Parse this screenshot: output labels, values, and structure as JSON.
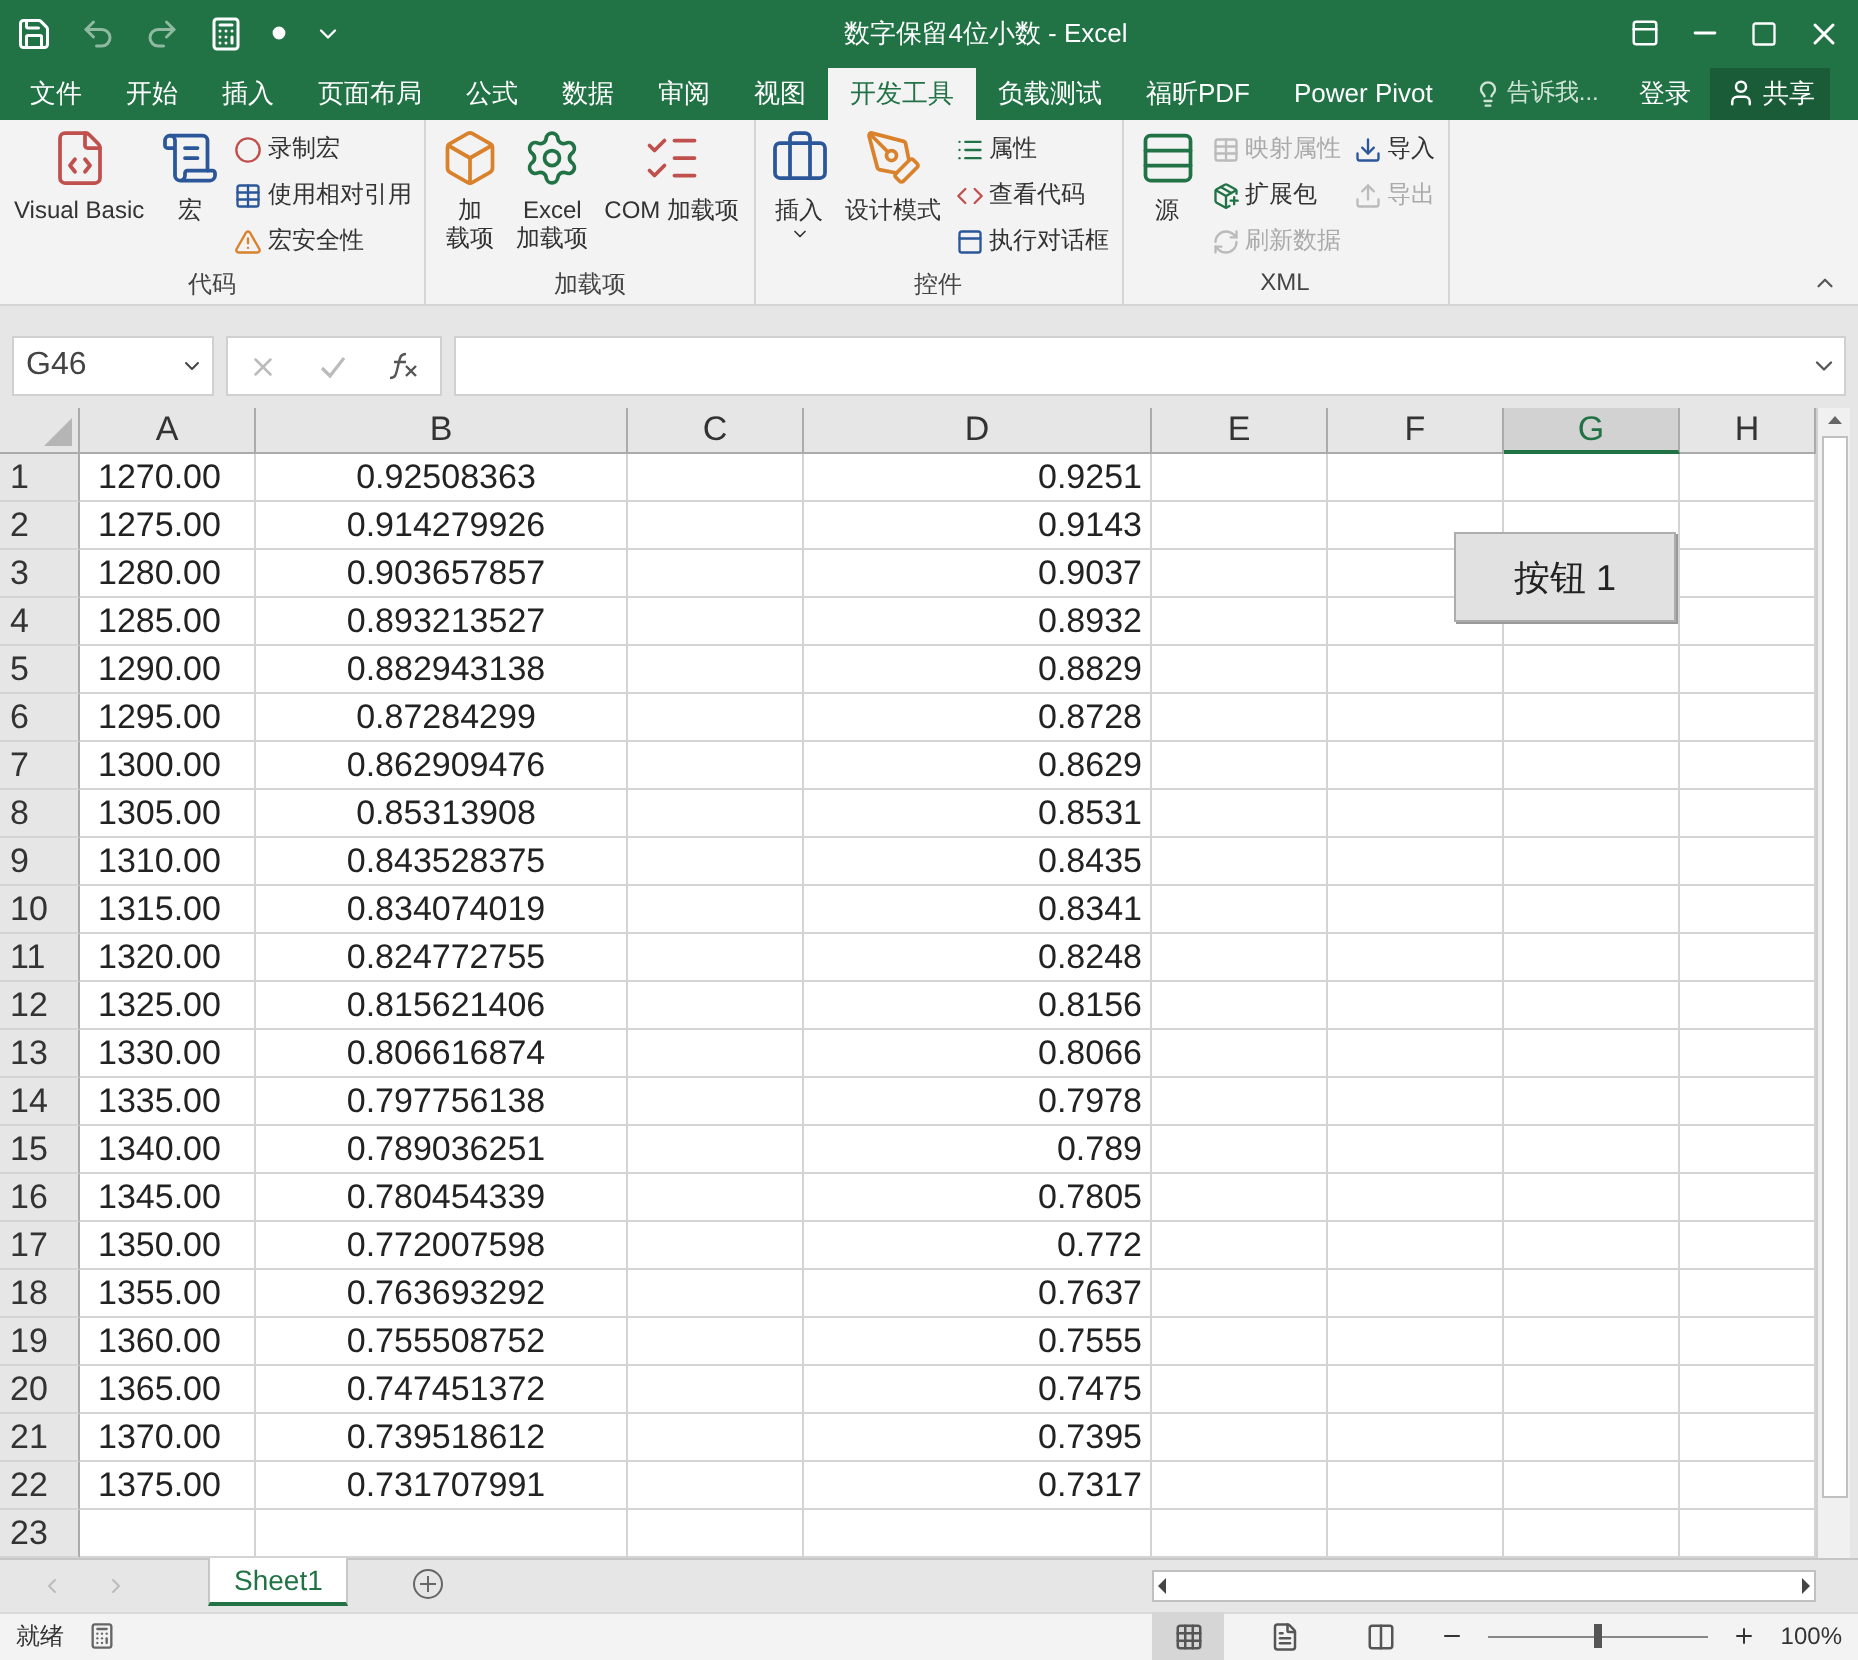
{
  "window": {
    "title": "数字保留4位小数 - Excel"
  },
  "tabs": [
    {
      "label": "文件",
      "selected": false
    },
    {
      "label": "开始",
      "selected": false
    },
    {
      "label": "插入",
      "selected": false
    },
    {
      "label": "页面布局",
      "selected": false
    },
    {
      "label": "公式",
      "selected": false
    },
    {
      "label": "数据",
      "selected": false
    },
    {
      "label": "审阅",
      "selected": false
    },
    {
      "label": "视图",
      "selected": false
    },
    {
      "label": "开发工具",
      "selected": true
    },
    {
      "label": "负载测试",
      "selected": false
    },
    {
      "label": "福昕PDF",
      "selected": false
    },
    {
      "label": "Power Pivot",
      "selected": false
    }
  ],
  "tell_me": {
    "placeholder": "告诉我..."
  },
  "login": "登录",
  "share": "共享",
  "ribbon_groups": [
    {
      "name": "代码",
      "items": [
        {
          "kind": "large",
          "lines": [
            "Visual Basic"
          ],
          "disabled": false
        },
        {
          "kind": "large",
          "lines": [
            "宏"
          ],
          "disabled": false
        },
        {
          "kind": "small",
          "lines": [
            "录制宏"
          ],
          "disabled": false
        },
        {
          "kind": "small",
          "lines": [
            "使用相对引用"
          ],
          "disabled": false
        },
        {
          "kind": "small",
          "lines": [
            "宏安全性"
          ],
          "disabled": false
        }
      ]
    },
    {
      "name": "加载项",
      "items": [
        {
          "kind": "large",
          "lines": [
            "加",
            "载项"
          ],
          "disabled": false
        },
        {
          "kind": "large",
          "lines": [
            "Excel",
            "加载项"
          ],
          "disabled": false
        },
        {
          "kind": "large",
          "lines": [
            "COM 加载项"
          ],
          "disabled": false
        }
      ]
    },
    {
      "name": "控件",
      "items": [
        {
          "kind": "large",
          "lines": [
            "插入"
          ],
          "dropdown": true,
          "disabled": false
        },
        {
          "kind": "large",
          "lines": [
            "设计模式"
          ],
          "disabled": false
        },
        {
          "kind": "small",
          "lines": [
            "属性"
          ],
          "disabled": false
        },
        {
          "kind": "small",
          "lines": [
            "查看代码"
          ],
          "disabled": false
        },
        {
          "kind": "small",
          "lines": [
            "执行对话框"
          ],
          "disabled": false
        }
      ]
    },
    {
      "name": "XML",
      "items": [
        {
          "kind": "large",
          "lines": [
            "源"
          ],
          "disabled": false
        },
        {
          "kind": "small",
          "lines": [
            "映射属性"
          ],
          "disabled": true
        },
        {
          "kind": "small",
          "lines": [
            "扩展包"
          ],
          "disabled": false
        },
        {
          "kind": "small",
          "lines": [
            "刷新数据"
          ],
          "disabled": true
        },
        {
          "kind": "small",
          "lines": [
            "导入"
          ],
          "disabled": false
        },
        {
          "kind": "small",
          "lines": [
            "导出"
          ],
          "disabled": true
        }
      ]
    }
  ],
  "name_box": "G46",
  "columns": [
    {
      "label": "A",
      "selected": false
    },
    {
      "label": "B",
      "selected": false
    },
    {
      "label": "C",
      "selected": false
    },
    {
      "label": "D",
      "selected": false
    },
    {
      "label": "E",
      "selected": false
    },
    {
      "label": "F",
      "selected": false
    },
    {
      "label": "G",
      "selected": true
    },
    {
      "label": "H",
      "selected": false
    }
  ],
  "rows": [
    {
      "n": "1",
      "a": "1270.00",
      "b": "0.92508363",
      "d": "0.9251"
    },
    {
      "n": "2",
      "a": "1275.00",
      "b": "0.914279926",
      "d": "0.9143"
    },
    {
      "n": "3",
      "a": "1280.00",
      "b": "0.903657857",
      "d": "0.9037"
    },
    {
      "n": "4",
      "a": "1285.00",
      "b": "0.893213527",
      "d": "0.8932"
    },
    {
      "n": "5",
      "a": "1290.00",
      "b": "0.882943138",
      "d": "0.8829"
    },
    {
      "n": "6",
      "a": "1295.00",
      "b": "0.87284299",
      "d": "0.8728"
    },
    {
      "n": "7",
      "a": "1300.00",
      "b": "0.862909476",
      "d": "0.8629"
    },
    {
      "n": "8",
      "a": "1305.00",
      "b": "0.85313908",
      "d": "0.8531"
    },
    {
      "n": "9",
      "a": "1310.00",
      "b": "0.843528375",
      "d": "0.8435"
    },
    {
      "n": "10",
      "a": "1315.00",
      "b": "0.834074019",
      "d": "0.8341"
    },
    {
      "n": "11",
      "a": "1320.00",
      "b": "0.824772755",
      "d": "0.8248"
    },
    {
      "n": "12",
      "a": "1325.00",
      "b": "0.815621406",
      "d": "0.8156"
    },
    {
      "n": "13",
      "a": "1330.00",
      "b": "0.806616874",
      "d": "0.8066"
    },
    {
      "n": "14",
      "a": "1335.00",
      "b": "0.797756138",
      "d": "0.7978"
    },
    {
      "n": "15",
      "a": "1340.00",
      "b": "0.789036251",
      "d": "0.789"
    },
    {
      "n": "16",
      "a": "1345.00",
      "b": "0.780454339",
      "d": "0.7805"
    },
    {
      "n": "17",
      "a": "1350.00",
      "b": "0.772007598",
      "d": "0.772"
    },
    {
      "n": "18",
      "a": "1355.00",
      "b": "0.763693292",
      "d": "0.7637"
    },
    {
      "n": "19",
      "a": "1360.00",
      "b": "0.755508752",
      "d": "0.7555"
    },
    {
      "n": "20",
      "a": "1365.00",
      "b": "0.747451372",
      "d": "0.7475"
    },
    {
      "n": "21",
      "a": "1370.00",
      "b": "0.739518612",
      "d": "0.7395"
    },
    {
      "n": "22",
      "a": "1375.00",
      "b": "0.731707991",
      "d": "0.7317"
    },
    {
      "n": "23"
    }
  ],
  "form_button": "按钮 1",
  "sheets": [
    {
      "name": "Sheet1",
      "selected": true
    }
  ],
  "status": "就绪",
  "views": [
    {
      "selected": true
    },
    {
      "selected": false
    },
    {
      "selected": false
    }
  ],
  "zoom": {
    "level": 0.5,
    "reading": "100%"
  }
}
